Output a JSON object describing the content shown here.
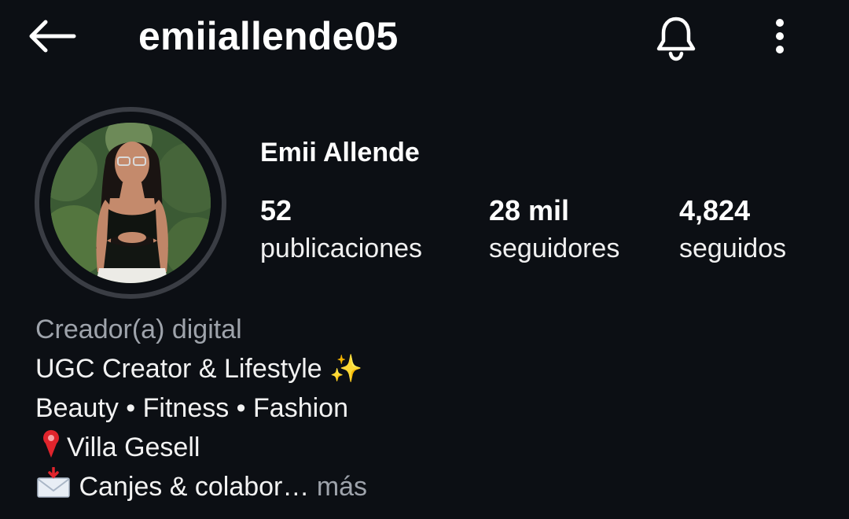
{
  "header": {
    "username": "emiiallende05",
    "icons": [
      "back-arrow-icon",
      "bell-icon",
      "more-vertical-icon"
    ]
  },
  "profile": {
    "display_name": "Emii Allende",
    "avatar": "profile-photo"
  },
  "stats": [
    {
      "value": "52",
      "label": "publicaciones"
    },
    {
      "value": "28 mil",
      "label": "seguidores"
    },
    {
      "value": "4,824",
      "label": "seguidos"
    }
  ],
  "bio": {
    "category": "Creador(a) digital",
    "line1": "UGC Creator & Lifestyle ✨",
    "line2": "Beauty • Fitness • Fashion",
    "line3": "Villa Gesell",
    "line4": "Canjes & colabor…",
    "more_label": "más"
  },
  "colors": {
    "background": "#0c0f14",
    "text": "#ffffff",
    "muted": "#9ea3ab",
    "avatar_ring": "#3a3d44"
  }
}
